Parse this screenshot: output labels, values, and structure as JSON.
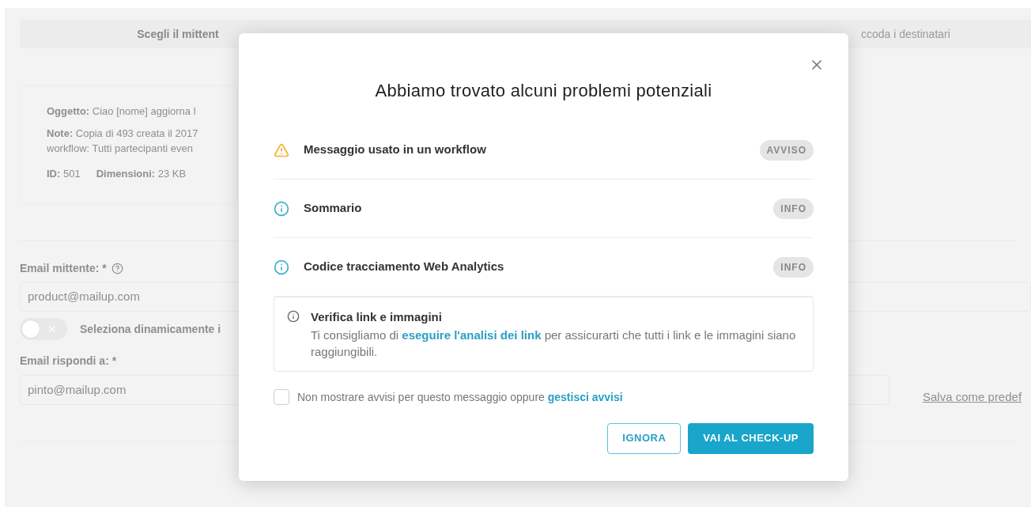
{
  "steps": [
    {
      "label": "Scegli il mittent",
      "selected": true
    },
    {
      "label": "ccoda i destinatari",
      "selected": false
    }
  ],
  "summary": {
    "subject_label": "Oggetto:",
    "subject": "Ciao [nome] aggiorna l",
    "notes_label": "Note:",
    "notes": "Copia di 493 creata il 2017",
    "notes_line_2": "workflow: Tutti partecipanti even",
    "id_label": "ID:",
    "id": "501",
    "size_label": "Dimensioni:",
    "size": "23 KB"
  },
  "sender": {
    "label": "Email mittente: *",
    "value": "product@mailup.com",
    "toggle": {
      "label": "Seleziona dinamicamente i",
      "on": false
    },
    "reply_label": "Email rispondi a: *",
    "reply_value": "pinto@mailup.com",
    "save_link": "Salva come predef"
  },
  "dialog": {
    "title": "Abbiamo trovato alcuni problemi potenziali",
    "issues": [
      {
        "kind": "warning",
        "label": "Messaggio usato in un workflow",
        "badge": "AVVISO"
      },
      {
        "kind": "info",
        "label": "Sommario",
        "badge": "INFO"
      },
      {
        "kind": "info",
        "label": "Codice tracciamento Web Analytics",
        "badge": "INFO"
      }
    ],
    "notice": {
      "title": "Verifica link e immagini",
      "text_before": "Ti consigliamo di",
      "link": "eseguire l'analisi dei link",
      "text_after": "per assicurarti che tutti i link e le immagini siano raggiungibili."
    },
    "dont_show": {
      "checked": false,
      "label": "Non mostrare avvisi per questo messaggio oppure",
      "link": "gestisci avvisi"
    },
    "buttons": [
      {
        "kind": "secondary",
        "label": "IGNORA"
      },
      {
        "kind": "primary",
        "label": "VAI AL CHECK-UP"
      }
    ]
  }
}
